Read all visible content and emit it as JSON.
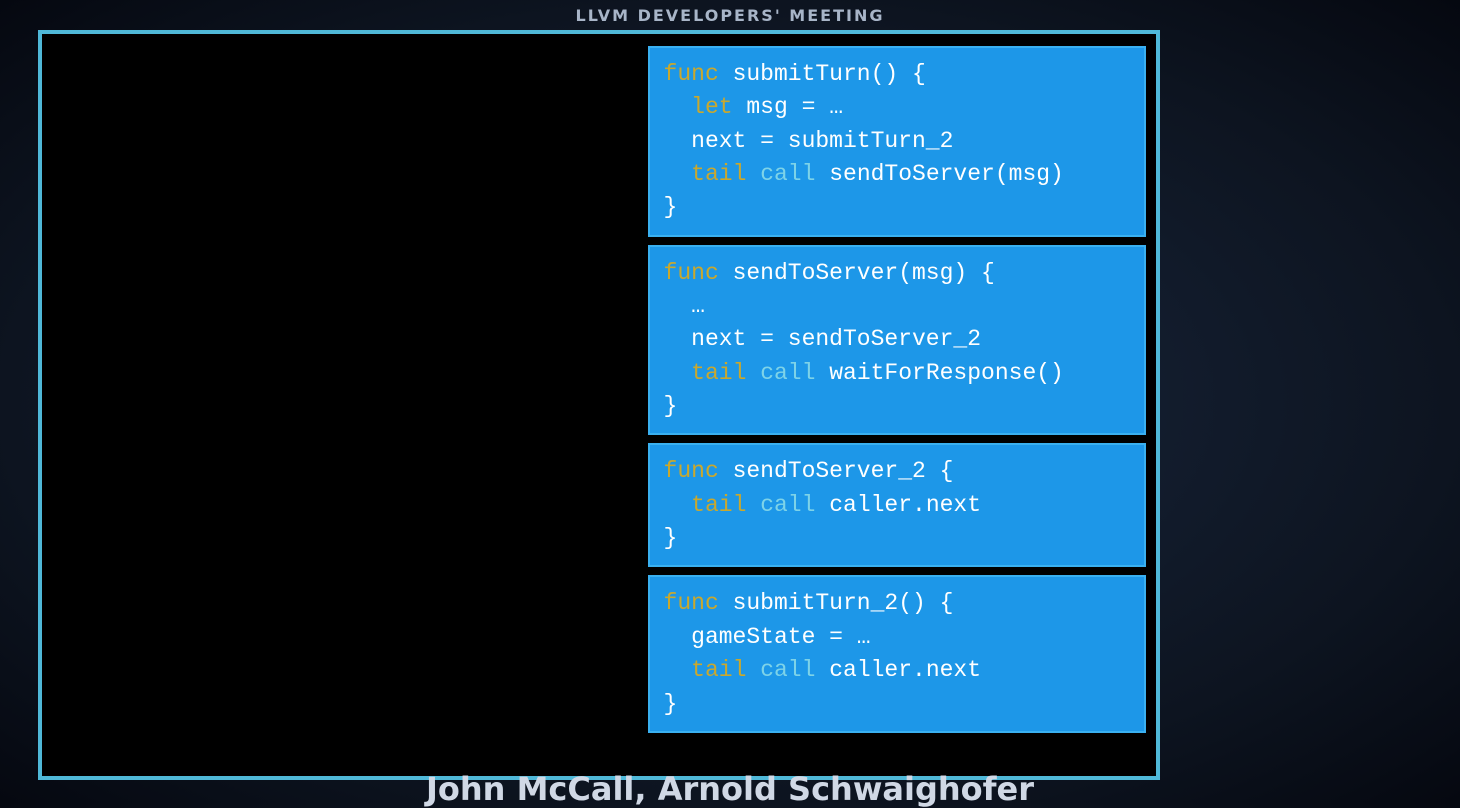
{
  "header": {
    "title": "LLVM DEVELOPERS' MEETING"
  },
  "authors": "John McCall, Arnold Schwaighofer",
  "code_blocks": [
    {
      "lines": [
        {
          "tokens": [
            {
              "t": "func",
              "c": "kw-func"
            },
            {
              "t": " submitTurn() {"
            }
          ]
        },
        {
          "tokens": [
            {
              "t": "  "
            },
            {
              "t": "let",
              "c": "kw-let"
            },
            {
              "t": " msg = …"
            }
          ]
        },
        {
          "tokens": [
            {
              "t": "  next = submitTurn_2"
            }
          ]
        },
        {
          "tokens": [
            {
              "t": "  "
            },
            {
              "t": "tail",
              "c": "kw-tail"
            },
            {
              "t": " "
            },
            {
              "t": "call",
              "c": "kw-call"
            },
            {
              "t": " sendToServer(msg)"
            }
          ]
        },
        {
          "tokens": [
            {
              "t": "}"
            }
          ]
        }
      ]
    },
    {
      "lines": [
        {
          "tokens": [
            {
              "t": "func",
              "c": "kw-func"
            },
            {
              "t": " sendToServer(msg) {"
            }
          ]
        },
        {
          "tokens": [
            {
              "t": "  …"
            }
          ]
        },
        {
          "tokens": [
            {
              "t": "  next = sendToServer_2"
            }
          ]
        },
        {
          "tokens": [
            {
              "t": "  "
            },
            {
              "t": "tail",
              "c": "kw-tail"
            },
            {
              "t": " "
            },
            {
              "t": "call",
              "c": "kw-call"
            },
            {
              "t": " waitForResponse()"
            }
          ]
        },
        {
          "tokens": [
            {
              "t": "}"
            }
          ]
        }
      ]
    },
    {
      "lines": [
        {
          "tokens": [
            {
              "t": "func",
              "c": "kw-func"
            },
            {
              "t": " sendToServer_2 {"
            }
          ]
        },
        {
          "tokens": [
            {
              "t": "  "
            },
            {
              "t": "tail",
              "c": "kw-tail"
            },
            {
              "t": " "
            },
            {
              "t": "call",
              "c": "kw-call"
            },
            {
              "t": " caller.next"
            }
          ]
        },
        {
          "tokens": [
            {
              "t": "}"
            }
          ]
        }
      ]
    },
    {
      "lines": [
        {
          "tokens": [
            {
              "t": "func",
              "c": "kw-func"
            },
            {
              "t": " submitTurn_2() {"
            }
          ]
        },
        {
          "tokens": [
            {
              "t": "  gameState = …"
            }
          ]
        },
        {
          "tokens": [
            {
              "t": "  "
            },
            {
              "t": "tail",
              "c": "kw-tail"
            },
            {
              "t": " "
            },
            {
              "t": "call",
              "c": "kw-call"
            },
            {
              "t": " caller.next"
            }
          ]
        },
        {
          "tokens": [
            {
              "t": "}"
            }
          ]
        }
      ]
    }
  ]
}
